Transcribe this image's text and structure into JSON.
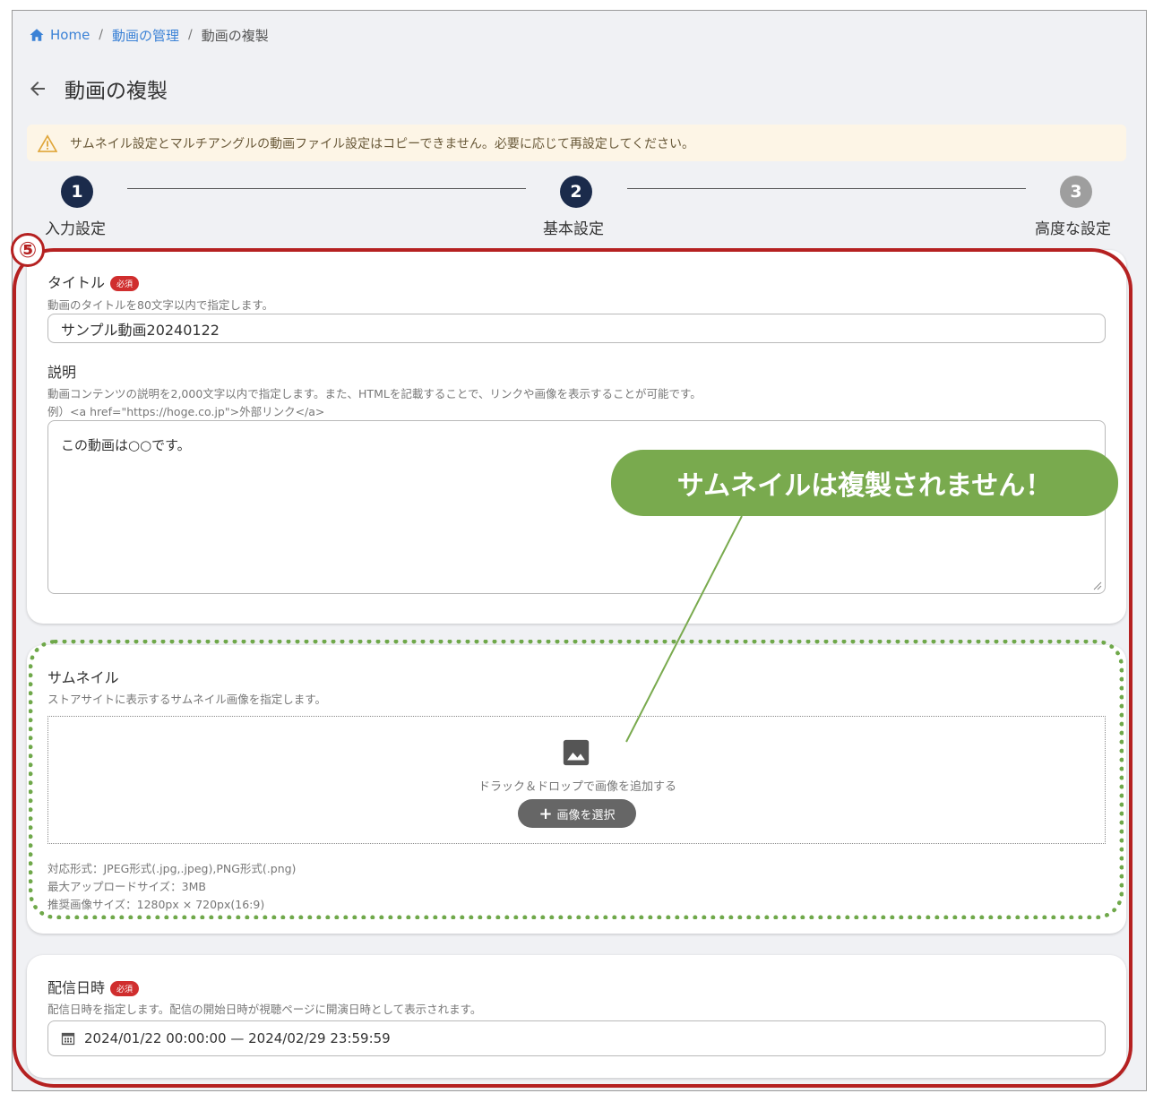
{
  "breadcrumb": {
    "home": "Home",
    "videos": "動画の管理",
    "current": "動画の複製"
  },
  "page": {
    "title": "動画の複製"
  },
  "alert": {
    "message": "サムネイル設定とマルチアングルの動画ファイル設定はコピーできません。必要に応じて再設定してください。"
  },
  "stepper": {
    "steps": [
      {
        "number": "1",
        "label": "入力設定",
        "state": "done"
      },
      {
        "number": "2",
        "label": "基本設定",
        "state": "active"
      },
      {
        "number": "3",
        "label": "高度な設定",
        "state": "pending"
      }
    ]
  },
  "form": {
    "required_badge": "必須",
    "title": {
      "label": "タイトル",
      "hint": "動画のタイトルを80文字以内で指定します。",
      "value": "サンプル動画20240122"
    },
    "description": {
      "label": "説明",
      "hint1": "動画コンテンツの説明を2,000文字以内で指定します。また、HTMLを記載することで、リンクや画像を表示することが可能です。",
      "hint2": "例）<a href=\"https://hoge.co.jp\">外部リンク</a>",
      "value": "この動画は○○です。"
    },
    "thumbnail": {
      "label": "サムネイル",
      "hint": "ストアサイトに表示するサムネイル画像を指定します。",
      "drop_text": "ドラック＆ドロップで画像を追加する",
      "select_button": "画像を選択",
      "format_note": "対応形式：JPEG形式(.jpg,.jpeg),PNG形式(.png)",
      "size_note": "最大アップロードサイズ：3MB",
      "recommend_note": "推奨画像サイズ：1280px × 720px(16:9)"
    },
    "delivery": {
      "label": "配信日時",
      "hint": "配信日時を指定します。配信の開始日時が視聴ページに開演日時として表示されます。",
      "value": "2024/01/22 00:00:00 — 2024/02/29 23:59:59"
    }
  },
  "annotation": {
    "marker": "⑤",
    "callout": "サムネイルは複製されません！"
  },
  "colors": {
    "link": "#3b82d6",
    "step_active": "#1b2b4b",
    "step_pending": "#9e9e9e",
    "required": "#d02e2e",
    "annotation_red": "#b52121",
    "annotation_green": "#79aa4e"
  },
  "icons": {
    "home": "home-icon",
    "back": "arrow-left-icon",
    "warning": "warning-icon",
    "image": "image-icon",
    "plus": "plus-icon",
    "calendar": "calendar-icon"
  }
}
